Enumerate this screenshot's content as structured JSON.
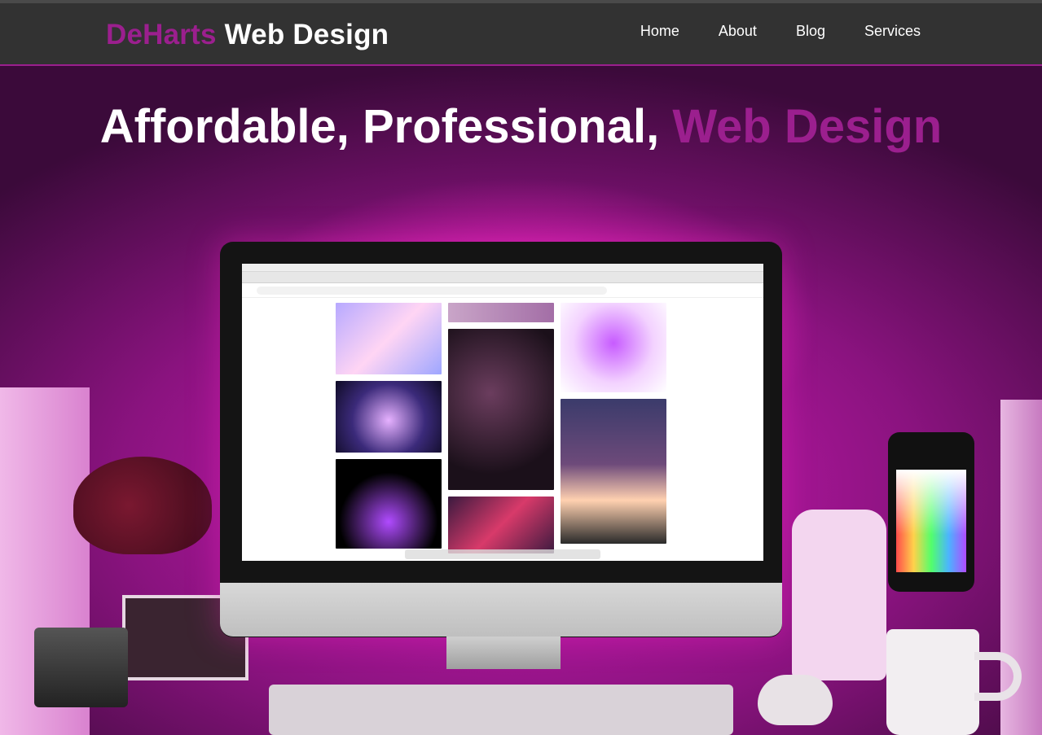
{
  "header": {
    "brand_part1": "DeHarts",
    "brand_part2": "Web Design",
    "nav": [
      {
        "label": "Home"
      },
      {
        "label": "About"
      },
      {
        "label": "Blog"
      },
      {
        "label": "Services"
      }
    ]
  },
  "hero": {
    "title_main": "Affordable, Professional,",
    "title_accent": "Web Design"
  },
  "colors": {
    "brand_purple": "#9b1f8e",
    "header_bg": "#323232",
    "white": "#ffffff"
  },
  "icons": {
    "apple_logo": "apple-icon"
  }
}
